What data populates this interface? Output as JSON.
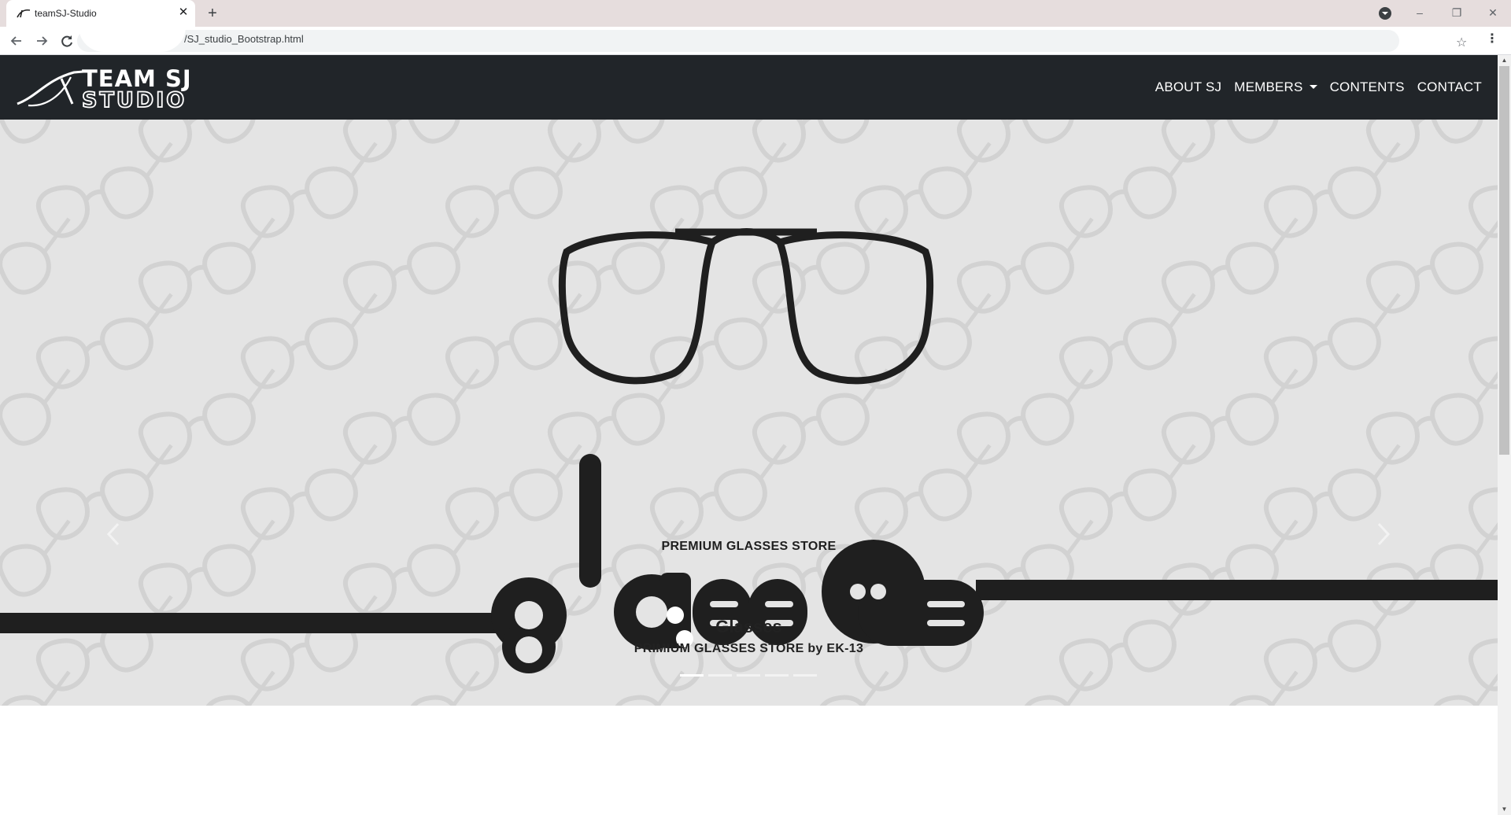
{
  "browser": {
    "tab_title": "teamSJ-Studio",
    "tab_close": "✕",
    "new_tab": "+",
    "url": "/SJ_studio_Bootstrap.html",
    "window_controls": [
      "–",
      "❐",
      "✕"
    ]
  },
  "site": {
    "brand_line1": "TEAM SJ",
    "brand_line2": "STUDIO",
    "nav": [
      "ABOUT SJ",
      "MEMBERS",
      "CONTENTS",
      "CONTACT"
    ]
  },
  "carousel": {
    "logo_text": "glasses",
    "tagline": "PREMIUM GLASSES STORE",
    "caption_title": "Glasses",
    "caption_text": "PRIMIUM GLASSES STORE by EK-13",
    "active_slide": 1,
    "slide_count": 5
  },
  "colors": {
    "navbar": "#212529",
    "hero_bg": "#e4e4e4",
    "ink": "#1f1f1f",
    "tabstrip": "#e6dddd"
  },
  "icons": [
    "back-arrow-icon",
    "forward-arrow-icon",
    "reload-icon",
    "star-icon",
    "menu-kebab-icon",
    "profile-icon",
    "prev-chevron-icon",
    "next-chevron-icon"
  ]
}
